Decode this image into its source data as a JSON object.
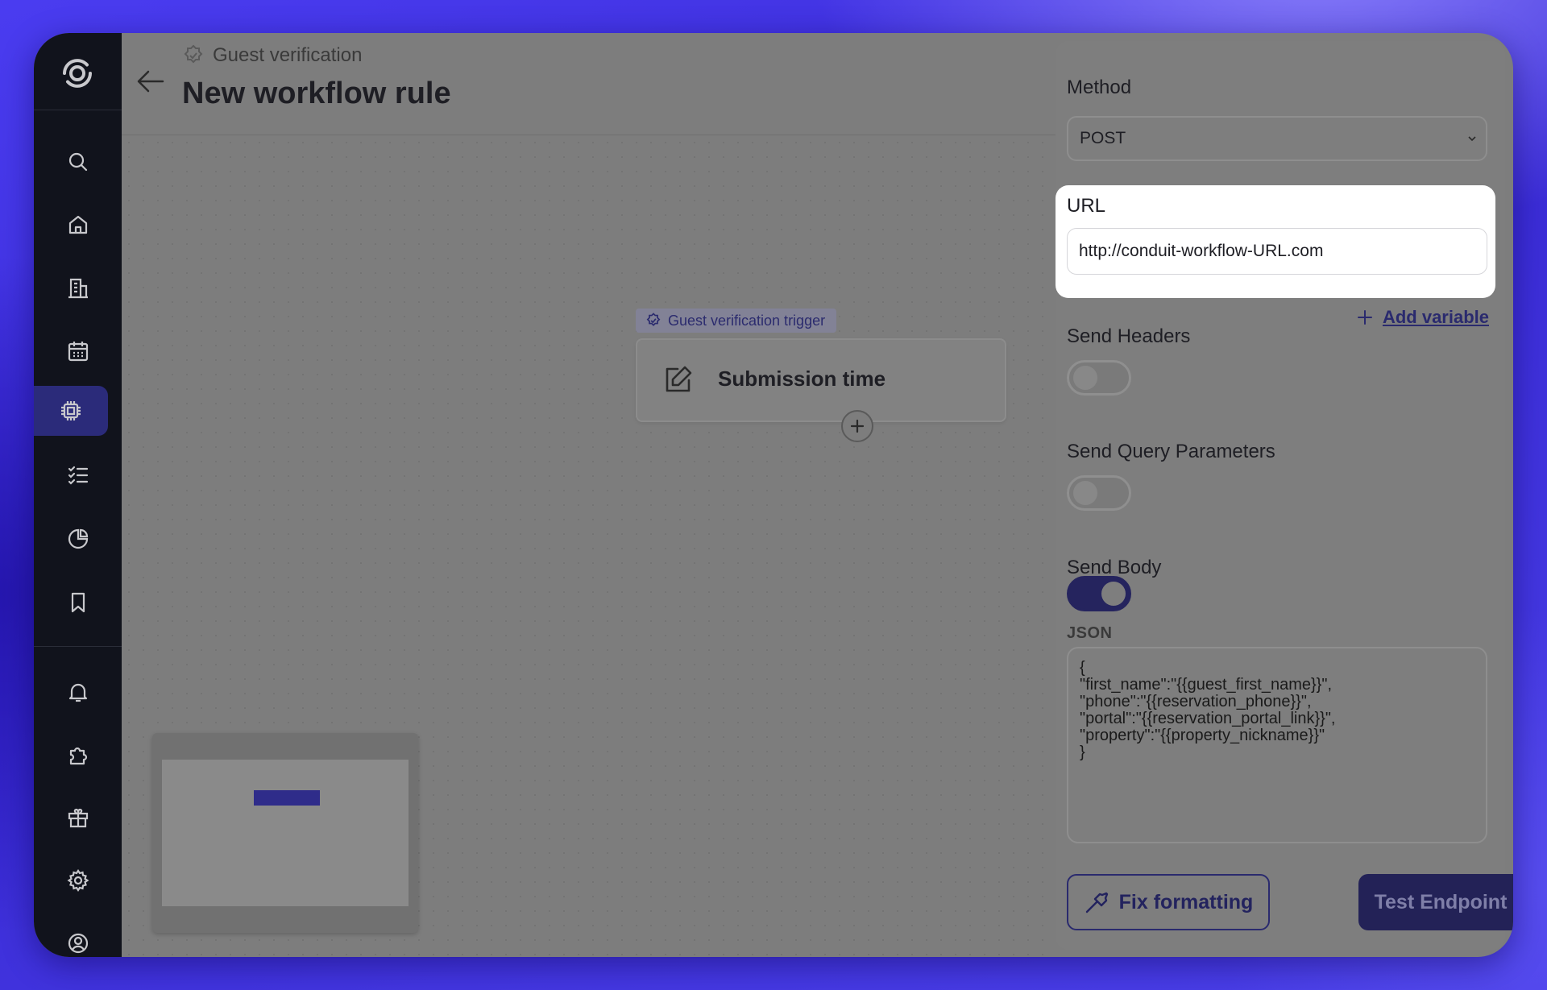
{
  "header": {
    "breadcrumb": "Guest verification",
    "title": "New workflow rule"
  },
  "canvas": {
    "trigger_tag": "Guest verification trigger",
    "node_title": "Submission time"
  },
  "panel": {
    "method_label": "Method",
    "method_value": "POST",
    "url_label": "URL",
    "url_value": "http://conduit-workflow-URL.com",
    "headers_label": "Send Headers",
    "add_variable": "Add variable",
    "headers_on": false,
    "query_label": "Send Query Parameters",
    "query_on": false,
    "body_label": "Send Body",
    "body_on": true,
    "json_label": "JSON",
    "json_body": "{\n\"first_name\":\"{{guest_first_name}}\",\n\"phone\":\"{{reservation_phone}}\",\n\"portal\":\"{{reservation_portal_link}}\",\n\"property\":\"{{property_nickname}}\"\n}",
    "fix_formatting": "Fix formatting",
    "test_endpoint": "Test Endpoint"
  },
  "sidebar": {
    "items": [
      "search-icon",
      "home-icon",
      "building-icon",
      "calendar-icon",
      "chip-icon",
      "checklist-icon",
      "chart-icon",
      "bookmark-icon",
      "bell-icon",
      "puzzle-icon",
      "gift-icon",
      "gear-icon",
      "user-circle-icon"
    ],
    "active": "chip-icon"
  },
  "colors": {
    "accent": "#25245e",
    "sidebar": "#11131c",
    "overlay": "#7d7d7d"
  }
}
